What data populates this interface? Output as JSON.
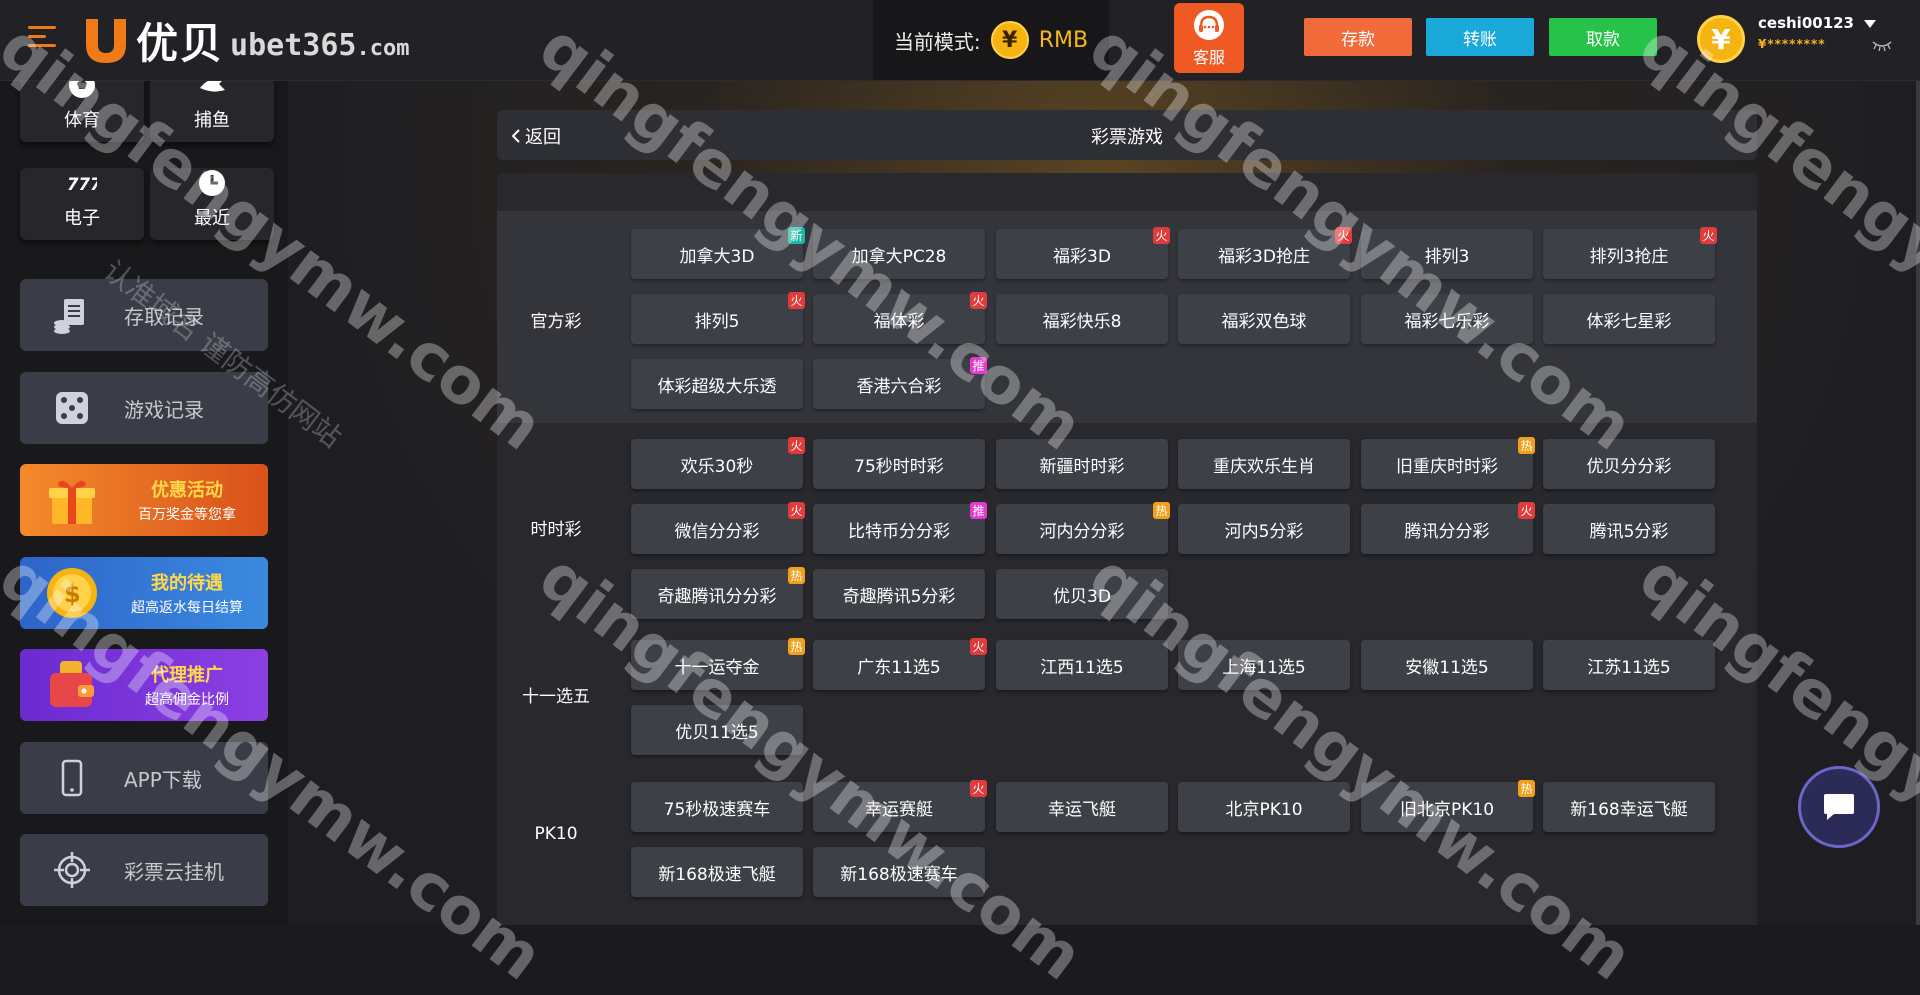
{
  "brand": {
    "name_cn": "优贝",
    "domain": "ubet365",
    "domain_suffix": ".com"
  },
  "mode": {
    "label": "当前模式:",
    "currency_symbol": "¥",
    "value": "RMB"
  },
  "service": {
    "label": "客服"
  },
  "actions": {
    "deposit": "存款",
    "transfer": "转账",
    "withdraw": "取款"
  },
  "user": {
    "avatar_symbol": "¥",
    "name": "ceshi00123",
    "balance": "¥********"
  },
  "sidebar": {
    "quick": {
      "sport": "体育",
      "fish": "捕鱼",
      "slot": "电子",
      "recent": "最近"
    },
    "records": "存取记录",
    "game_records": "游戏记录",
    "promo_activity": {
      "title": "优惠活动",
      "sub": "百万奖金等您拿"
    },
    "promo_vip": {
      "title": "我的待遇",
      "sub": "超高返水每日结算"
    },
    "promo_agent": {
      "title": "代理推广",
      "sub": "超高佣金比例"
    },
    "app": "APP下载",
    "cloud": "彩票云挂机"
  },
  "header": {
    "back": "返回",
    "title": "彩票游戏"
  },
  "badge_text": {
    "fire": "火",
    "hot": "热",
    "new": "新",
    "rec": "推"
  },
  "sections": {
    "official": {
      "label": "官方彩",
      "games": [
        {
          "name": "加拿大3D",
          "badge": "new"
        },
        {
          "name": "加拿大PC28",
          "badge": ""
        },
        {
          "name": "福彩3D",
          "badge": "fire"
        },
        {
          "name": "福彩3D抢庄",
          "badge": "fire"
        },
        {
          "name": "排列3",
          "badge": ""
        },
        {
          "name": "排列3抢庄",
          "badge": "fire"
        },
        {
          "name": "排列5",
          "badge": "fire"
        },
        {
          "name": "福体彩",
          "badge": "fire"
        },
        {
          "name": "福彩快乐8",
          "badge": ""
        },
        {
          "name": "福彩双色球",
          "badge": ""
        },
        {
          "name": "福彩七乐彩",
          "badge": ""
        },
        {
          "name": "体彩七星彩",
          "badge": ""
        },
        {
          "name": "体彩超级大乐透",
          "badge": ""
        },
        {
          "name": "香港六合彩",
          "badge": "rec"
        }
      ]
    },
    "ssc": {
      "label": "时时彩",
      "games": [
        {
          "name": "欢乐30秒",
          "badge": "fire"
        },
        {
          "name": "75秒时时彩",
          "badge": ""
        },
        {
          "name": "新疆时时彩",
          "badge": ""
        },
        {
          "name": "重庆欢乐生肖",
          "badge": ""
        },
        {
          "name": "旧重庆时时彩",
          "badge": "hot"
        },
        {
          "name": "优贝分分彩",
          "badge": ""
        },
        {
          "name": "微信分分彩",
          "badge": "fire"
        },
        {
          "name": "比特币分分彩",
          "badge": "rec"
        },
        {
          "name": "河内分分彩",
          "badge": "hot"
        },
        {
          "name": "河内5分彩",
          "badge": ""
        },
        {
          "name": "腾讯分分彩",
          "badge": "fire"
        },
        {
          "name": "腾讯5分彩",
          "badge": ""
        },
        {
          "name": "奇趣腾讯分分彩",
          "badge": "hot"
        },
        {
          "name": "奇趣腾讯5分彩",
          "badge": ""
        },
        {
          "name": "优贝3D",
          "badge": ""
        }
      ]
    },
    "eleven": {
      "label": "十一选五",
      "games": [
        {
          "name": "十一运夺金",
          "badge": "hot"
        },
        {
          "name": "广东11选5",
          "badge": "fire"
        },
        {
          "name": "江西11选5",
          "badge": ""
        },
        {
          "name": "上海11选5",
          "badge": ""
        },
        {
          "name": "安徽11选5",
          "badge": ""
        },
        {
          "name": "江苏11选5",
          "badge": ""
        },
        {
          "name": "优贝11选5",
          "badge": ""
        }
      ]
    },
    "pk10": {
      "label": "PK10",
      "games": [
        {
          "name": "75秒极速赛车",
          "badge": ""
        },
        {
          "name": "幸运赛艇",
          "badge": "fire"
        },
        {
          "name": "幸运飞艇",
          "badge": ""
        },
        {
          "name": "北京PK10",
          "badge": ""
        },
        {
          "name": "旧北京PK10",
          "badge": "hot"
        },
        {
          "name": "新168幸运飞艇",
          "badge": ""
        },
        {
          "name": "新168极速飞艇",
          "badge": ""
        },
        {
          "name": "新168极速赛车",
          "badge": ""
        }
      ]
    }
  },
  "watermark": {
    "text": "qingfengymw.com",
    "cn": "认准域名 谨防高仿网站"
  },
  "colors": {
    "accent": "#f07a18",
    "deposit": "#f16a3a",
    "transfer": "#1aa9d8",
    "withdraw": "#26c24a",
    "gold": "#f6b51d"
  }
}
